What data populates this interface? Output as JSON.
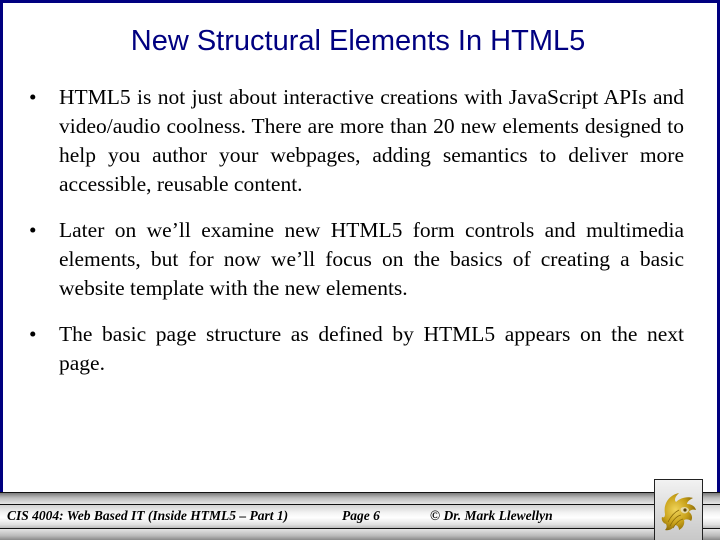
{
  "slide": {
    "title": "New Structural Elements In HTML5",
    "bullet_symbol": "•",
    "bullets": [
      {
        "text": "HTML5 is not just about interactive creations with JavaScript APIs and video/audio coolness.  There are more than 20 new elements designed to help you author your webpages, adding semantics to deliver more accessible, reusable content."
      },
      {
        "text": "Later on we’ll examine new HTML5 form controls and multimedia elements, but for now we’ll focus on the basics of creating a basic website template with the new elements."
      },
      {
        "text": "The basic page structure as defined by HTML5 appears on the next page."
      }
    ]
  },
  "footer": {
    "course": "CIS 4004: Web Based IT (Inside HTML5 – Part 1)",
    "page": "Page 6",
    "copyright": "© Dr. Mark Llewellyn",
    "logo_icon": "pegasus-logo-icon"
  },
  "colors": {
    "frame": "#000080",
    "title": "#000080",
    "body_text": "#000000",
    "logo_gold": "#c9a21a"
  }
}
